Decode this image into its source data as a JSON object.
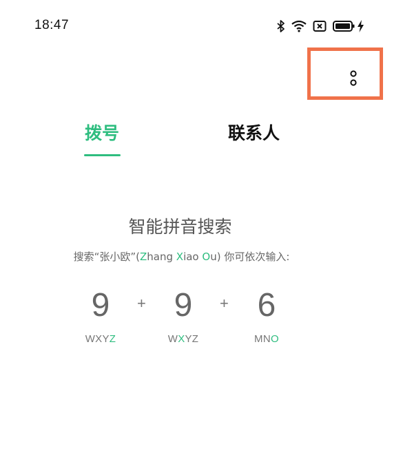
{
  "status_bar": {
    "time": "18:47",
    "icons": [
      "bluetooth-icon",
      "wifi-icon",
      "sim-disabled-icon",
      "battery-icon",
      "charging-icon"
    ]
  },
  "header": {
    "more_menu_icon": "vertical-ellipsis-icon",
    "highlight_color": "#f0724a"
  },
  "tabs": [
    {
      "label": "拨号",
      "active": true
    },
    {
      "label": "联系人",
      "active": false
    }
  ],
  "accent_color": "#2ebd7f",
  "hint": {
    "title": "智能拼音搜索",
    "desc_prefix": "搜索“张小欧”(",
    "desc_name": [
      {
        "hl": "Z",
        "rest": "hang "
      },
      {
        "hl": "X",
        "rest": "iao "
      },
      {
        "hl": "O",
        "rest": "u"
      }
    ],
    "desc_suffix": ") 你可依次输入:"
  },
  "key_sequence": [
    {
      "digit": "9",
      "letters_before": "WXY",
      "letters_hl": "Z",
      "letters_after": ""
    },
    {
      "digit": "9",
      "letters_before": "W",
      "letters_hl": "X",
      "letters_after": "YZ"
    },
    {
      "digit": "6",
      "letters_before": "MN",
      "letters_hl": "O",
      "letters_after": ""
    }
  ],
  "separator": "+"
}
